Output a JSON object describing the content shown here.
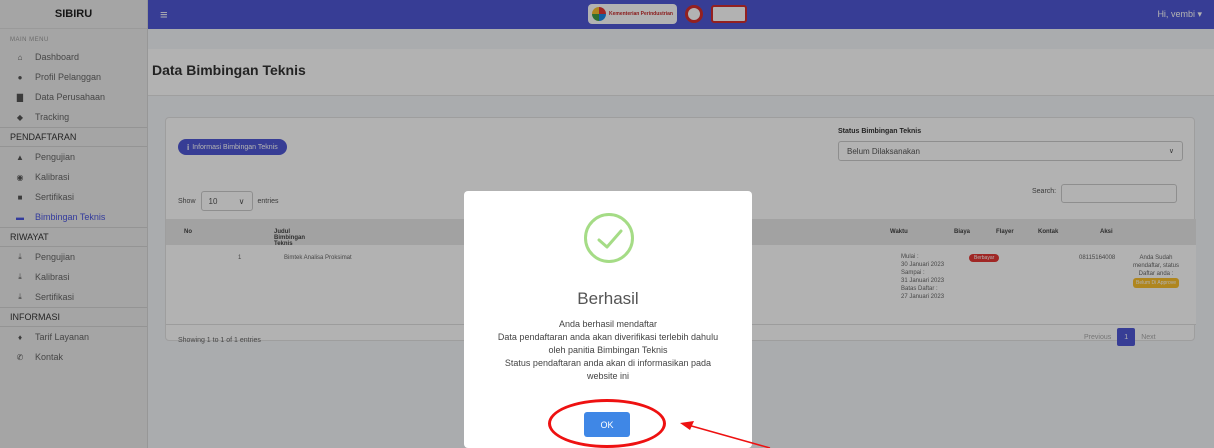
{
  "sidebar": {
    "brand": "SIBIRU",
    "main_menu_caption": "MAIN MENU",
    "main_items": [
      {
        "label": "Dashboard",
        "icon": "home-icon"
      },
      {
        "label": "Profil Pelanggan",
        "icon": "user-icon"
      },
      {
        "label": "Data Perusahaan",
        "icon": "building-icon"
      },
      {
        "label": "Tracking",
        "icon": "map-pin-icon"
      }
    ],
    "pendaftaran_header": "PENDAFTARAN",
    "pendaftaran_items": [
      {
        "label": "Pengujian",
        "icon": "flask-icon"
      },
      {
        "label": "Kalibrasi",
        "icon": "gauge-icon"
      },
      {
        "label": "Sertifikasi",
        "icon": "certificate-icon"
      },
      {
        "label": "Bimbingan Teknis",
        "icon": "chalkboard-icon",
        "active": true
      }
    ],
    "riwayat_header": "RIWAYAT",
    "riwayat_items": [
      {
        "label": "Pengujian",
        "icon": "download-icon"
      },
      {
        "label": "Kalibrasi",
        "icon": "download-icon"
      },
      {
        "label": "Sertifikasi",
        "icon": "download-icon"
      }
    ],
    "informasi_header": "INFORMASI",
    "informasi_items": [
      {
        "label": "Tarif Layanan",
        "icon": "tag-icon"
      },
      {
        "label": "Kontak",
        "icon": "phone-icon"
      }
    ]
  },
  "topbar": {
    "user_greeting": "Hi, vembi",
    "logo_a_text": "Kementerian Perindustrian"
  },
  "page": {
    "title": "Data Bimbingan Teknis",
    "info_button": "Informasi Bimbingan Teknis",
    "status_label": "Status Bimbingan Teknis",
    "status_value": "Belum Dilaksanakan",
    "show_label": "Show",
    "entries_value": "10",
    "entries_label": "entries",
    "search_label": "Search:",
    "showing_text": "Showing 1 to 1 of 1 entries",
    "pager_prev": "Previous",
    "pager_current": "1",
    "pager_next": "Next"
  },
  "table": {
    "headers": [
      "No",
      "Judul Bimbingan Teknis",
      "Waktu",
      "Biaya",
      "Flayer",
      "Kontak",
      "Aksi"
    ],
    "row": {
      "no": "1",
      "judul": "Bimtek Analisa Proksimat",
      "waktu_mulai_label": "Mulai :",
      "waktu_mulai": "30 Januari 2023",
      "waktu_sampai_label": "Sampai :",
      "waktu_sampai": "31 Januari 2023",
      "batas_label": "Batas Daftar :",
      "batas": "27 Januari 2023",
      "biaya": "Berbayar",
      "kontak": "08115164008",
      "aksi_text_1": "Anda Sudah",
      "aksi_text_2": "mendaftar, status",
      "aksi_text_3": "Daftar anda :",
      "aksi_badge": "Belum Di Approve"
    }
  },
  "modal": {
    "title": "Berhasil",
    "line1": "Anda berhasil mendaftar",
    "line2": "Data pendaftaran anda akan diverifikasi terlebih dahulu",
    "line3": "oleh panitia Bimbingan Teknis",
    "line4": "Status pendaftaran anda akan di informasikan pada",
    "line5": "website ini",
    "ok_label": "OK"
  },
  "colors": {
    "primary": "#5058d6",
    "ok_button": "#3f87e6",
    "success": "#a5dc86",
    "annotation": "#ee1111"
  }
}
